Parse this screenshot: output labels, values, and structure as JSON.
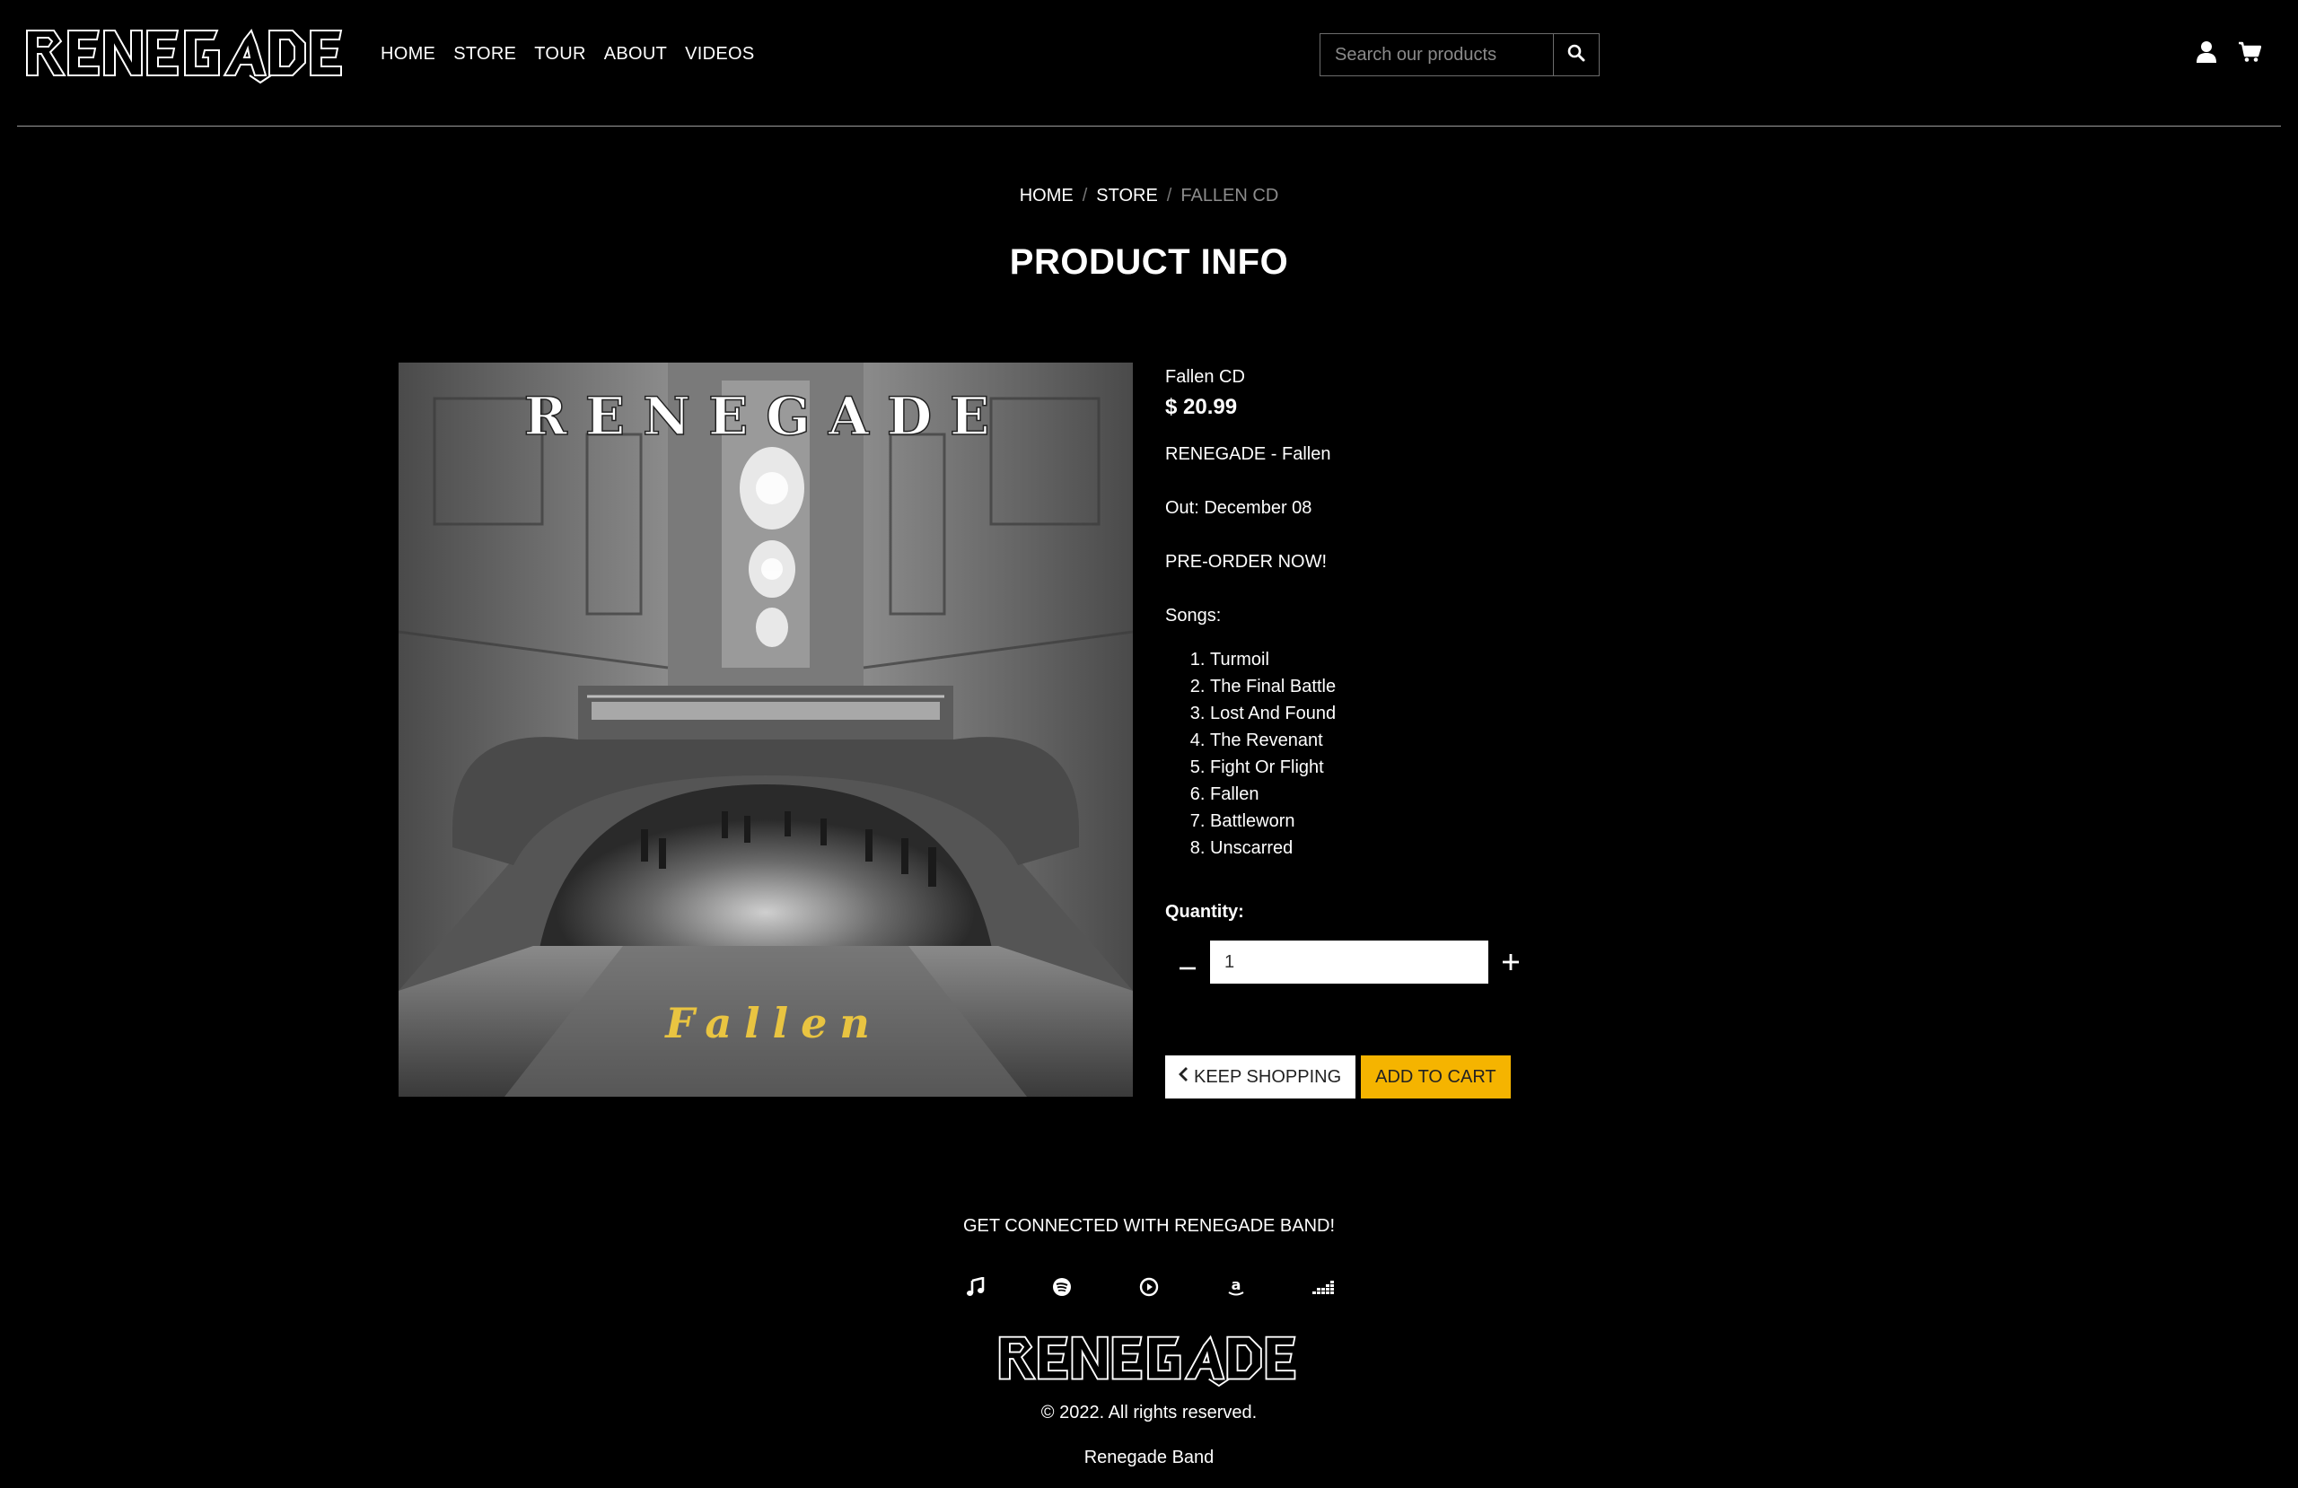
{
  "brand": {
    "logo_text": "RENEGADE"
  },
  "nav": {
    "items": [
      {
        "label": "HOME"
      },
      {
        "label": "STORE"
      },
      {
        "label": "TOUR"
      },
      {
        "label": "ABOUT"
      },
      {
        "label": "VIDEOS"
      }
    ]
  },
  "search": {
    "placeholder": "Search our products",
    "icon": "search-icon"
  },
  "header_icons": [
    "user-icon",
    "cart-icon"
  ],
  "breadcrumb": {
    "items": [
      {
        "label": "HOME"
      },
      {
        "label": "STORE"
      },
      {
        "label": "FALLEN CD"
      }
    ],
    "separator": "/"
  },
  "page_title": "PRODUCT INFO",
  "product": {
    "image": {
      "band_title": "RENEGADE",
      "album_title": "Fallen"
    },
    "name": "Fallen CD",
    "price": "$ 20.99",
    "description_line": "RENEGADE - Fallen",
    "release": "Out: December 08",
    "preorder": "PRE-ORDER NOW!",
    "songs_label": "Songs:",
    "songs": [
      "Turmoil",
      "The Final Battle",
      "Lost And Found",
      "The Revenant",
      "Fight Or Flight",
      "Fallen",
      "Battleworn",
      "Unscarred"
    ],
    "quantity_label": "Quantity:",
    "quantity_value": "1",
    "keep_shopping": "KEEP SHOPPING",
    "add_to_cart": "ADD TO CART"
  },
  "colors": {
    "background": "#000000",
    "accent": "#f5b400",
    "divider": "#9a9a9a"
  },
  "footer": {
    "connect": "GET CONNECTED WITH RENEGADE BAND!",
    "socials": [
      "apple-music-icon",
      "spotify-icon",
      "youtube-music-icon",
      "amazon-icon",
      "deezer-icon"
    ],
    "copyright": "© 2022. All rights reserved.",
    "band": "Renegade Band"
  }
}
